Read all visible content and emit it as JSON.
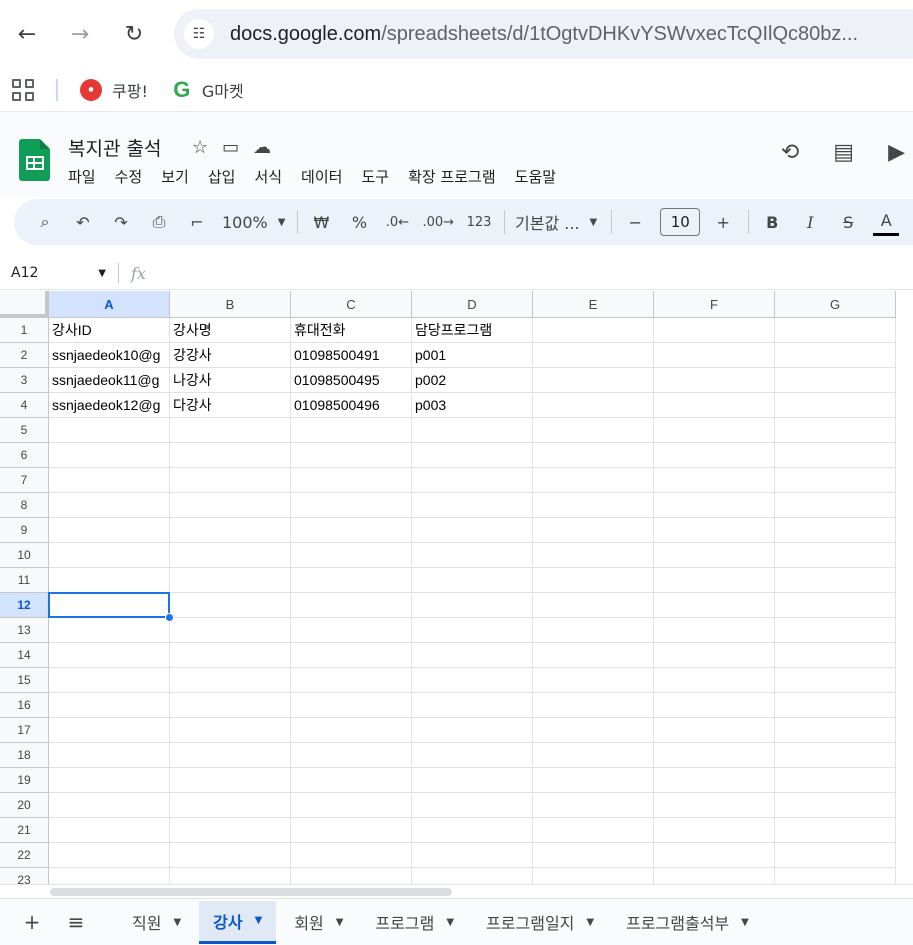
{
  "browser": {
    "url_main": "docs.google.com",
    "url_path": "/spreadsheets/d/1tOgtvDHKvYSWvxecTcQIlQc80bz...",
    "back_icon": "←",
    "forward_icon": "→",
    "reload_icon": "↻"
  },
  "bookmarks": [
    {
      "label": "쿠팡!"
    },
    {
      "label": "G마켓"
    }
  ],
  "doc": {
    "title": "복지관 출석",
    "menu": [
      "파일",
      "수정",
      "보기",
      "삽입",
      "서식",
      "데이터",
      "도구",
      "확장 프로그램",
      "도움말"
    ]
  },
  "toolbar": {
    "zoom": "100%",
    "currency": "₩",
    "percent": "%",
    "dec_decrease": ".0←",
    "dec_increase": ".00→",
    "number_format": "123",
    "font": "기본값 ...",
    "font_size": "10",
    "bold": "B",
    "italic": "I",
    "strike": "S",
    "text_color": "A"
  },
  "formula": {
    "name_box": "A12",
    "fx": "fx"
  },
  "grid": {
    "columns": [
      "A",
      "B",
      "C",
      "D",
      "E",
      "F",
      "G"
    ],
    "rows": [
      "1",
      "2",
      "3",
      "4",
      "5",
      "6",
      "7",
      "8",
      "9",
      "10",
      "11",
      "12",
      "13",
      "14",
      "15",
      "16",
      "17",
      "18",
      "19",
      "20",
      "21",
      "22",
      "23"
    ],
    "cells": [
      [
        "강사ID",
        "강사명",
        "휴대전화",
        "담당프로그램"
      ],
      [
        "ssnjaedeok10@g",
        "강강사",
        "01098500491",
        "p001"
      ],
      [
        "ssnjaedeok11@g",
        "나강사",
        "01098500495",
        "p002"
      ],
      [
        "ssnjaedeok12@g",
        "다강사",
        "01098500496",
        "p003"
      ]
    ],
    "selected": "A12"
  },
  "sheets": {
    "tabs": [
      "직원",
      "강사",
      "회원",
      "프로그램",
      "프로그램일지",
      "프로그램출석부"
    ],
    "active": "강사"
  }
}
